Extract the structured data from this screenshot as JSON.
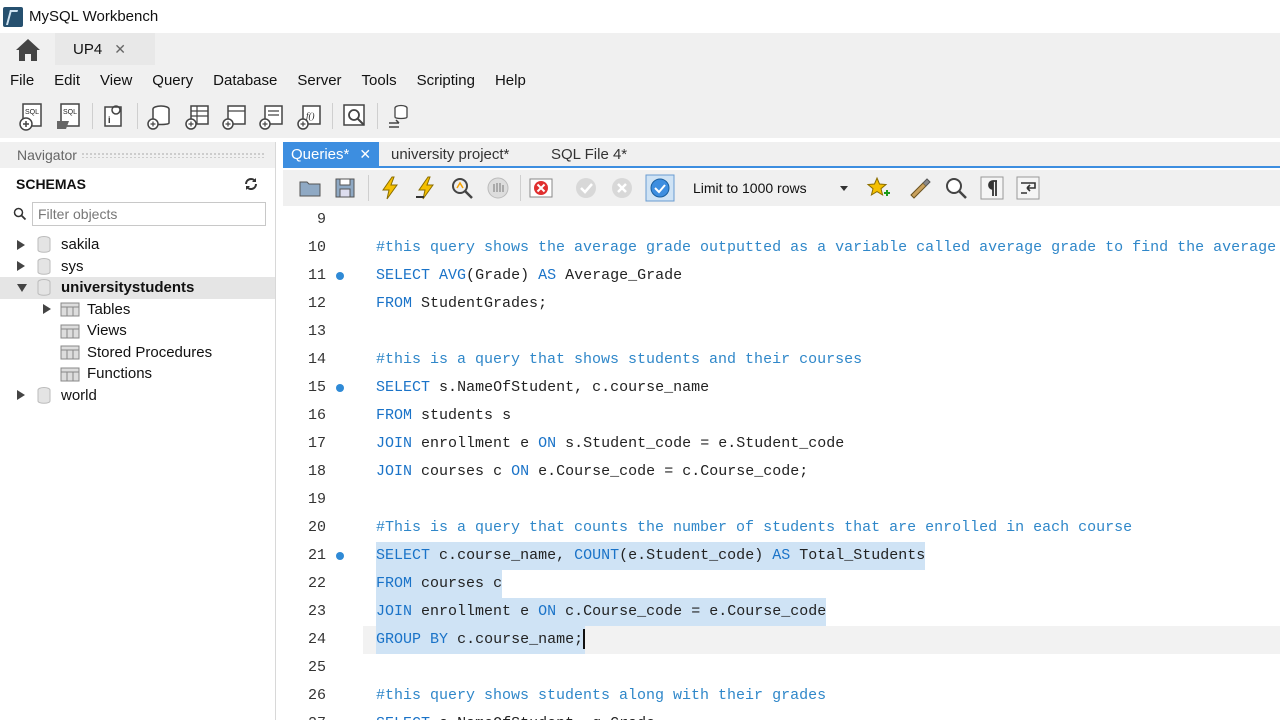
{
  "window": {
    "title": "MySQL Workbench"
  },
  "connection_tab": {
    "label": "UP4",
    "close": "✕"
  },
  "menu": [
    "File",
    "Edit",
    "View",
    "Query",
    "Database",
    "Server",
    "Tools",
    "Scripting",
    "Help"
  ],
  "navigator": {
    "header": "Navigator",
    "schemas_title": "SCHEMAS",
    "filter_placeholder": "Filter objects",
    "schemas": [
      {
        "name": "sakila",
        "expanded": false
      },
      {
        "name": "sys",
        "expanded": false
      },
      {
        "name": "universitystudents",
        "expanded": true,
        "selected": true,
        "children": [
          "Tables",
          "Views",
          "Stored Procedures",
          "Functions"
        ]
      },
      {
        "name": "world",
        "expanded": false
      }
    ]
  },
  "editor_tabs": [
    {
      "label": "Queries*",
      "active": true,
      "close": "✕"
    },
    {
      "label": "university project*",
      "active": false
    },
    {
      "label": "SQL File 4*",
      "active": false
    }
  ],
  "editor_toolbar": {
    "limit_label": "Limit to 1000 rows"
  },
  "code_lines": [
    {
      "n": "9",
      "text": ""
    },
    {
      "n": "10",
      "text": "#this query shows the average grade outputted as a variable called average grade to find the average"
    },
    {
      "n": "11",
      "text": "SELECT AVG(Grade) AS Average_Grade",
      "marker": true
    },
    {
      "n": "12",
      "text": "FROM StudentGrades;"
    },
    {
      "n": "13",
      "text": ""
    },
    {
      "n": "14",
      "text": "#this is a query that shows students and their courses"
    },
    {
      "n": "15",
      "text": "SELECT s.NameOfStudent, c.course_name",
      "marker": true
    },
    {
      "n": "16",
      "text": "FROM students s"
    },
    {
      "n": "17",
      "text": "JOIN enrollment e ON s.Student_code = e.Student_code"
    },
    {
      "n": "18",
      "text": "JOIN courses c ON e.Course_code = c.Course_code;"
    },
    {
      "n": "19",
      "text": ""
    },
    {
      "n": "20",
      "text": "#This is a query that counts the number of students that are enrolled in each course"
    },
    {
      "n": "21",
      "text": "SELECT c.course_name, COUNT(e.Student_code) AS Total_Students",
      "marker": true,
      "selected": true
    },
    {
      "n": "22",
      "text": "FROM courses c",
      "selected": true
    },
    {
      "n": "23",
      "text": "JOIN enrollment e ON c.Course_code = e.Course_code",
      "selected": true
    },
    {
      "n": "24",
      "text": "GROUP BY c.course_name;",
      "selected": true,
      "current": true
    },
    {
      "n": "25",
      "text": ""
    },
    {
      "n": "26",
      "text": "#this query shows students along with their grades"
    },
    {
      "n": "27",
      "text": "SELECT s.NameOfStudent, g.Grade",
      "marker": true
    }
  ],
  "colors": {
    "accent": "#3d8ee0",
    "keyword": "#1a73c8",
    "comment": "#2f87c9",
    "selection": "#cfe3f5"
  }
}
